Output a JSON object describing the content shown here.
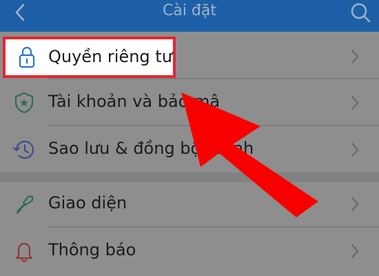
{
  "header": {
    "title": "Cài đặt",
    "back_icon": "chevron-left-icon",
    "search_icon": "search-icon"
  },
  "settings": {
    "items": [
      {
        "label": "Quyền riêng tư",
        "icon": "lock-icon"
      },
      {
        "label": "Tài khoản và bảo mậ",
        "icon": "shield-star-icon"
      },
      {
        "label": "Sao lưu & đồng bộ tin nh",
        "icon": "clock-history-icon"
      },
      {
        "label": "Giao diện",
        "icon": "paint-brush-icon"
      },
      {
        "label": "Thông báo",
        "icon": "bell-icon"
      }
    ]
  },
  "colors": {
    "header_bg": "#1e60a8",
    "highlight_border": "#e3262f",
    "arrow": "#f80000",
    "icon_blue": "#2f73c2",
    "icon_green": "#2e8a69",
    "icon_red": "#d0343a"
  }
}
